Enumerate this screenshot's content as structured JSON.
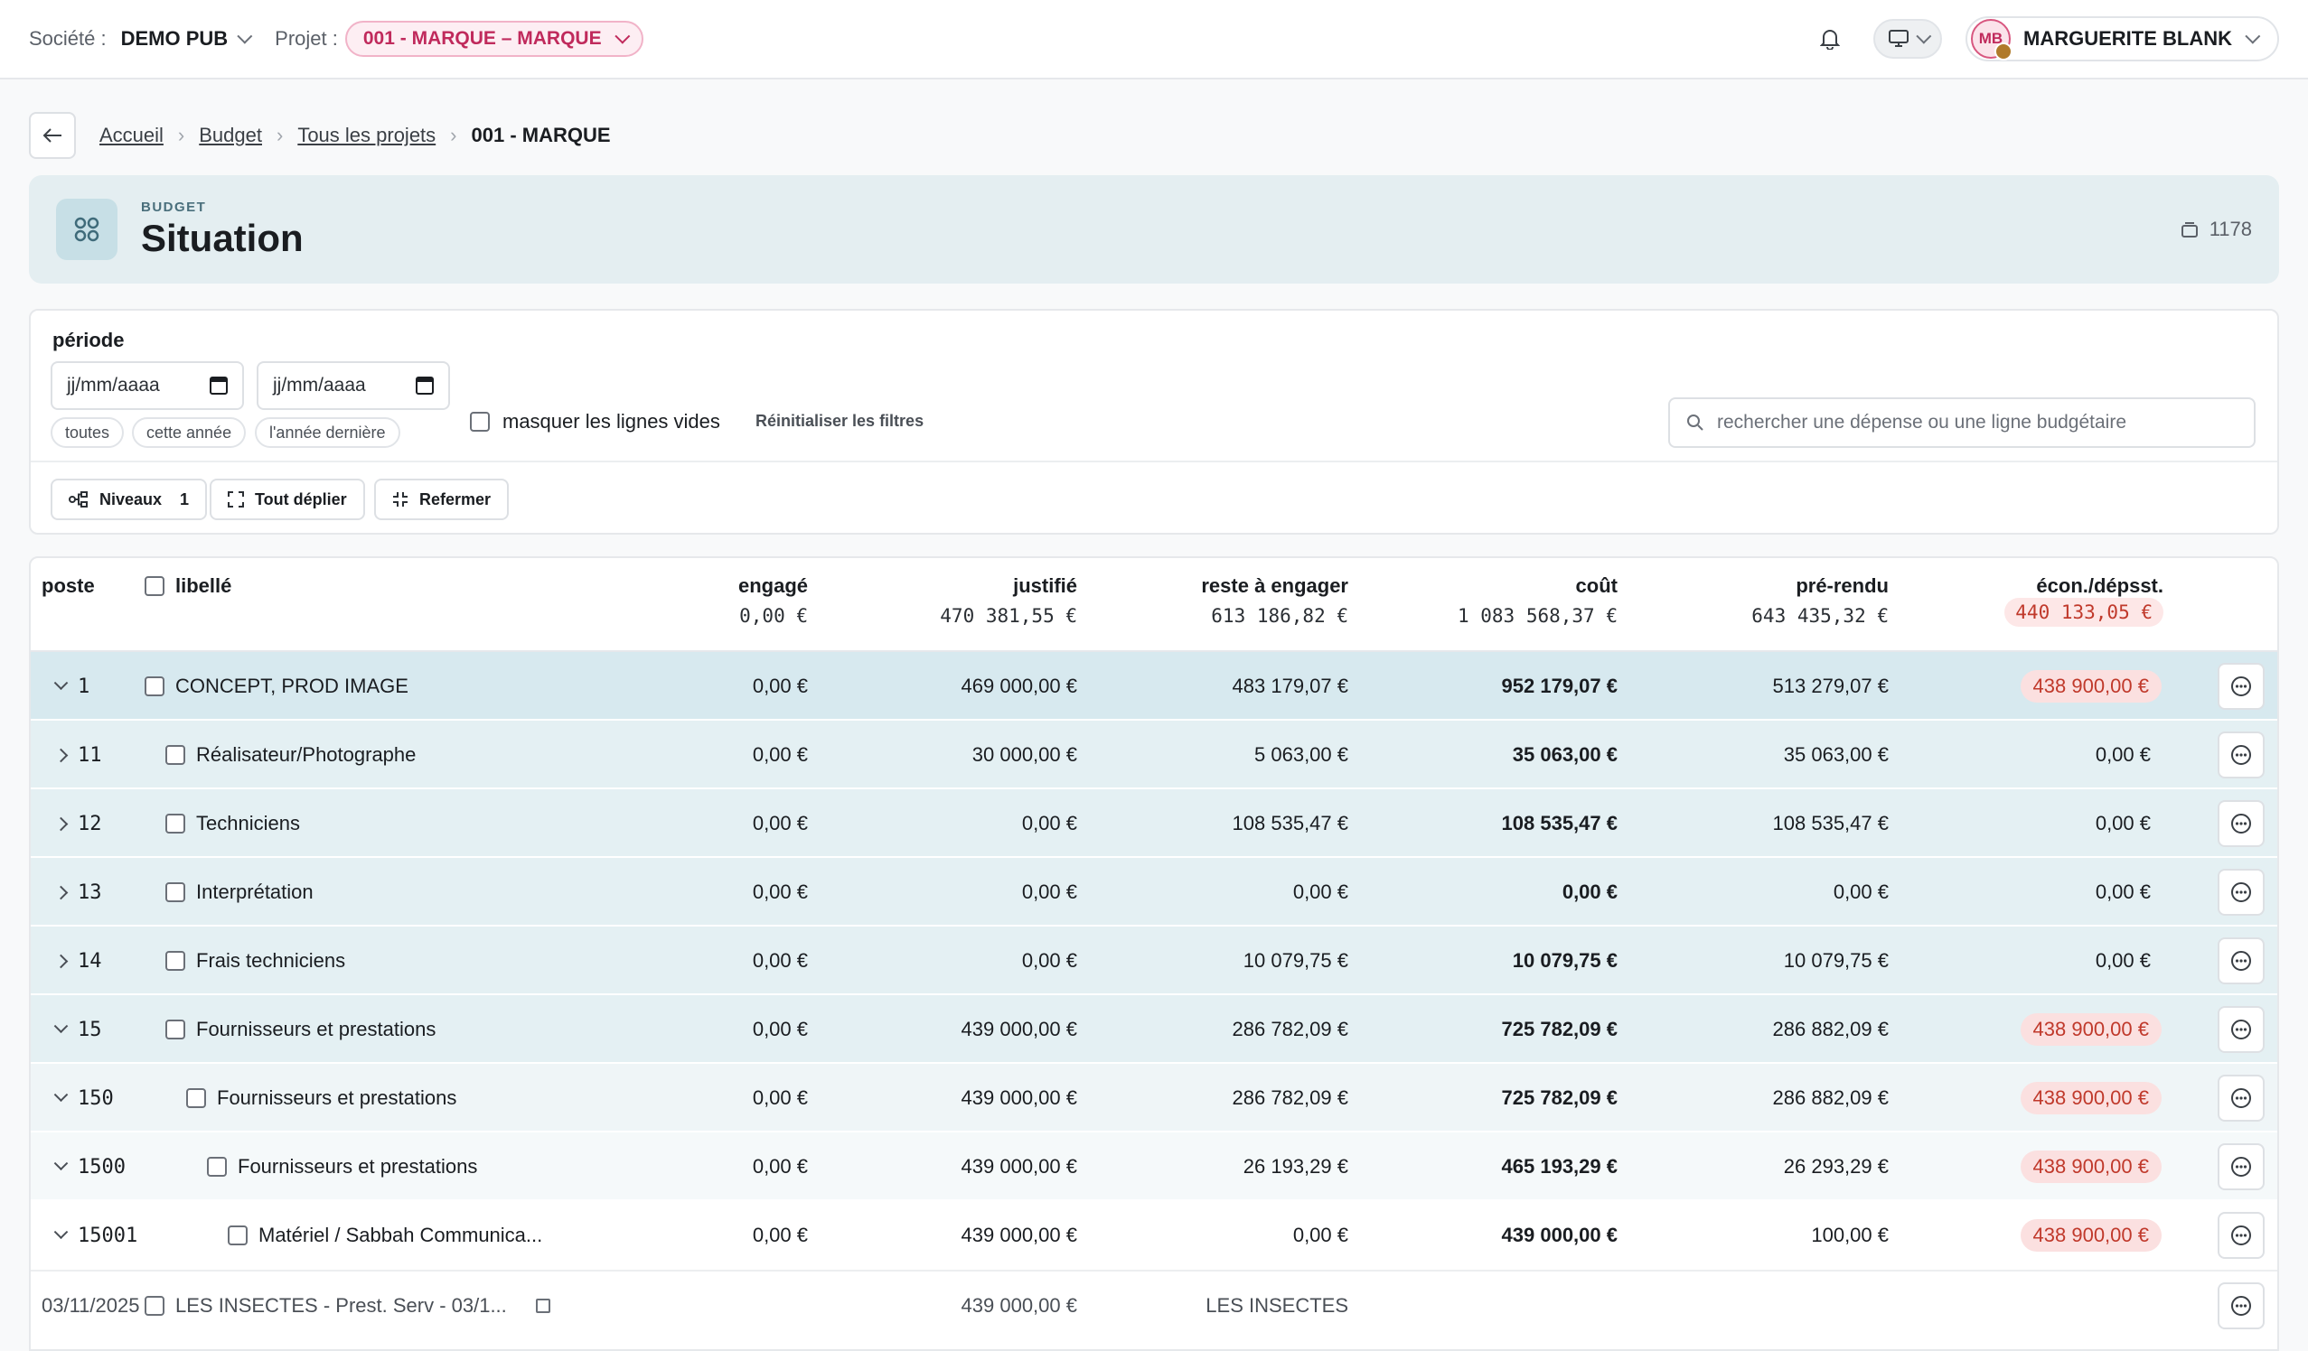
{
  "topbar": {
    "company_label": "Société :",
    "company_value": "DEMO PUB",
    "project_label": "Projet :",
    "project_value": "001 - MARQUE – MARQUE",
    "user_initials": "MB",
    "user_name": "MARGUERITE BLANK"
  },
  "breadcrumb": {
    "items": [
      "Accueil",
      "Budget",
      "Tous les projets"
    ],
    "current": "001 - MARQUE"
  },
  "header": {
    "eyebrow": "BUDGET",
    "title": "Situation",
    "count": "1178"
  },
  "filters": {
    "period_label": "période",
    "date_from_placeholder": "jj/mm/aaaa",
    "date_to_placeholder": "jj/mm/aaaa",
    "chips": [
      "toutes",
      "cette année",
      "l'année dernière"
    ],
    "hide_empty_label": "masquer les lignes vides",
    "reset_label": "Réinitialiser les filtres",
    "search_placeholder": "rechercher une dépense ou une ligne budgétaire",
    "levels_label": "Niveaux",
    "levels_value": "1",
    "expand_label": "Tout déplier",
    "collapse_label": "Refermer"
  },
  "table": {
    "columns": {
      "poste": "poste",
      "libelle": "libellé",
      "engage": "engagé",
      "justifie": "justifié",
      "reste": "reste à engager",
      "cout": "coût",
      "prerendu": "pré-rendu",
      "econ": "écon./dépsst."
    },
    "totals": {
      "engage": "0,00 €",
      "justifie": "470 381,55 €",
      "reste": "613 186,82 €",
      "cout": "1 083 568,37 €",
      "prerendu": "643 435,32 €",
      "econ": "440 133,05 €"
    },
    "rows": [
      {
        "poste": "1",
        "libelle": "CONCEPT, PROD IMAGE",
        "engage": "0,00 €",
        "justifie": "469 000,00 €",
        "reste": "483 179,07 €",
        "cout": "952 179,07 €",
        "prerendu": "513 279,07 €",
        "econ": "438 900,00 €"
      },
      {
        "poste": "11",
        "libelle": "Réalisateur/Photographe",
        "engage": "0,00 €",
        "justifie": "30 000,00 €",
        "reste": "5 063,00 €",
        "cout": "35 063,00 €",
        "prerendu": "35 063,00 €",
        "econ": "0,00 €"
      },
      {
        "poste": "12",
        "libelle": "Techniciens",
        "engage": "0,00 €",
        "justifie": "0,00 €",
        "reste": "108 535,47 €",
        "cout": "108 535,47 €",
        "prerendu": "108 535,47 €",
        "econ": "0,00 €"
      },
      {
        "poste": "13",
        "libelle": "Interprétation",
        "engage": "0,00 €",
        "justifie": "0,00 €",
        "reste": "0,00 €",
        "cout": "0,00 €",
        "prerendu": "0,00 €",
        "econ": "0,00 €"
      },
      {
        "poste": "14",
        "libelle": "Frais techniciens",
        "engage": "0,00 €",
        "justifie": "0,00 €",
        "reste": "10 079,75 €",
        "cout": "10 079,75 €",
        "prerendu": "10 079,75 €",
        "econ": "0,00 €"
      },
      {
        "poste": "15",
        "libelle": "Fournisseurs et prestations",
        "engage": "0,00 €",
        "justifie": "439 000,00 €",
        "reste": "286 782,09 €",
        "cout": "725 782,09 €",
        "prerendu": "286 882,09 €",
        "econ": "438 900,00 €"
      },
      {
        "poste": "150",
        "libelle": "Fournisseurs et prestations",
        "engage": "0,00 €",
        "justifie": "439 000,00 €",
        "reste": "286 782,09 €",
        "cout": "725 782,09 €",
        "prerendu": "286 882,09 €",
        "econ": "438 900,00 €"
      },
      {
        "poste": "1500",
        "libelle": "Fournisseurs et prestations",
        "engage": "0,00 €",
        "justifie": "439 000,00 €",
        "reste": "26 193,29 €",
        "cout": "465 193,29 €",
        "prerendu": "26 293,29 €",
        "econ": "438 900,00 €"
      },
      {
        "poste": "15001",
        "libelle": "Matériel / Sabbah Communica...",
        "engage": "0,00 €",
        "justifie": "439 000,00 €",
        "reste": "0,00 €",
        "cout": "439 000,00 €",
        "prerendu": "100,00 €",
        "econ": "438 900,00 €"
      }
    ],
    "expense": {
      "date": "03/11/2025",
      "libelle": "LES INSECTES - Prest. Serv - 03/1...",
      "justifie": "439 000,00 €",
      "supplier": "LES INSECTES"
    }
  }
}
